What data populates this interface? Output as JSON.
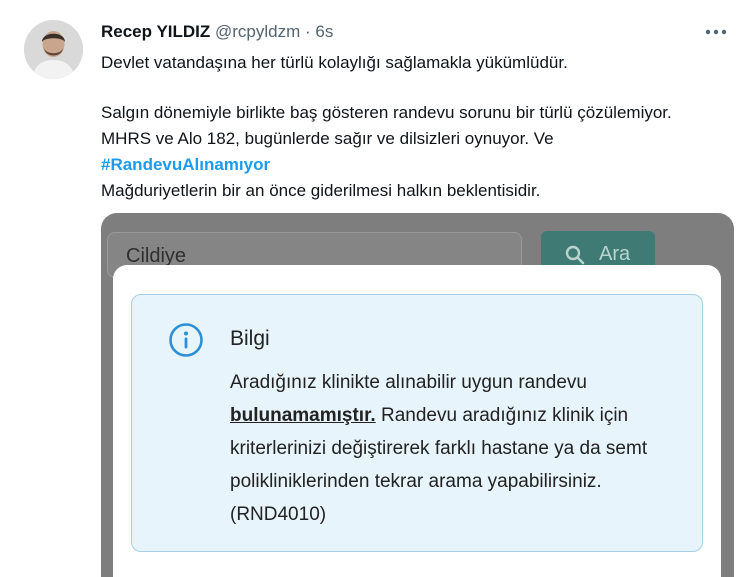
{
  "tweet": {
    "author_name": "Recep YILDIZ",
    "handle": "@rcpyldzm",
    "separator": "·",
    "time": "6s",
    "line1": "Devlet vatandaşına her türlü kolaylığı sağlamakla yükümlüdür.",
    "line2": "Salgın dönemiyle birlikte baş gösteren randevu sorunu bir türlü çözülemiyor.",
    "line3": "MHRS ve Alo 182, bugünlerde sağır ve dilsizleri oynuyor. Ve",
    "hashtag": "#RandevuAlınamıyor",
    "line4": "Mağduriyetlerin bir an önce giderilmesi halkın beklentisidir."
  },
  "icons": {
    "more": "more-options-icon",
    "search": "search-icon",
    "info": "info-icon"
  },
  "screenshot": {
    "search_value": "Cildiye",
    "search_button_label": "Ara",
    "alert_title": "Bilgi",
    "alert_msg_start": "Aradığınız klinikte alınabilir uygun randevu",
    "alert_msg_strong": "bulunamamıştır.",
    "alert_msg_end": " Randevu aradığınız klinik için kriterlerinizi değiştirerek farklı hastane ya da semt polikliniklerinden tekrar arama yapabilirsiniz. (RND4010)"
  },
  "colors": {
    "link": "#1d9bf0",
    "text": "#0f1419",
    "muted": "#536471",
    "alert_bg": "#e7f4fb",
    "alert_border": "#a7cfe3",
    "info_icon": "#2d8fd5",
    "search_button": "#3f7b74"
  }
}
